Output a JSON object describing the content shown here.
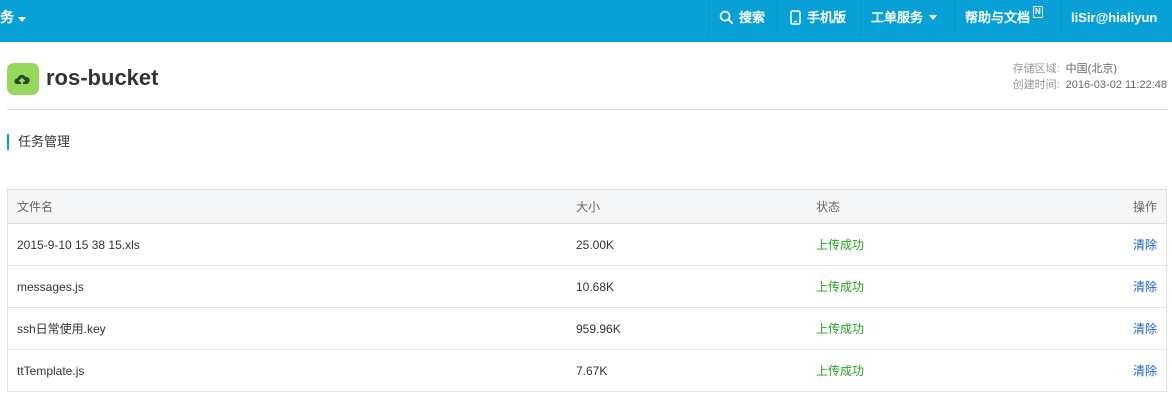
{
  "topbar": {
    "left_label": "务",
    "search_label": "搜索",
    "mobile_label": "手机版",
    "ticket_label": "工单服务",
    "help_label": "帮助与文档",
    "help_badge": "N",
    "user_label": "liSir@hialiyun",
    "accent": "#09a0d8"
  },
  "header": {
    "title": "ros-bucket",
    "region_label": "存储区域:",
    "region_value": "中国(北京)",
    "created_label": "创建时间:",
    "created_value": "2016-03-02 11:22:48"
  },
  "section": {
    "title": "任务管理"
  },
  "table": {
    "columns": {
      "name": "文件名",
      "size": "大小",
      "status": "状态",
      "op": "操作"
    },
    "rows": [
      {
        "name": "2015-9-10 15 38 15.xls",
        "size": "25.00K",
        "status": "上传成功",
        "op": "清除"
      },
      {
        "name": "messages.js",
        "size": "10.68K",
        "status": "上传成功",
        "op": "清除"
      },
      {
        "name": "ssh日常使用.key",
        "size": "959.96K",
        "status": "上传成功",
        "op": "清除"
      },
      {
        "name": "ttTemplate.js",
        "size": "7.67K",
        "status": "上传成功",
        "op": "清除"
      }
    ]
  }
}
